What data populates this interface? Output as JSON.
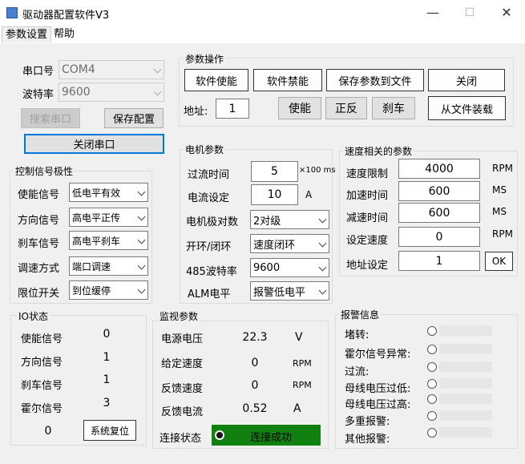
{
  "window": {
    "title": "驱动器配置软件V3",
    "minimize": "—",
    "maximize": "☐",
    "close": "✕"
  },
  "menu": {
    "items": [
      "参数设置",
      "帮助"
    ]
  },
  "serial": {
    "port_label": "串口号",
    "port_value": "COM4",
    "baud_label": "波特率",
    "baud_value": "9600",
    "search_button": "搜索串口",
    "save_config_button": "保存配置",
    "close_port_button": "关闭串口"
  },
  "param_ops": {
    "title": "参数操作",
    "enable_button": "软件使能",
    "disable_button": "软件禁能",
    "save_file_button": "保存参数到文件",
    "close_button": "关闭",
    "address_label": "地址:",
    "address_value": "1",
    "use_button": "使能",
    "forward_reverse_button": "正反",
    "brake_button": "刹车",
    "load_file_button": "从文件装载"
  },
  "control": {
    "title": "控制信号极性",
    "rows": [
      {
        "label": "使能信号",
        "value": "低电平有效"
      },
      {
        "label": "方向信号",
        "value": "高电平正传"
      },
      {
        "label": "刹车信号",
        "value": "高电平刹车"
      },
      {
        "label": "调速方式",
        "value": "端口调速"
      },
      {
        "label": "限位开关",
        "value": "到位缓停"
      }
    ]
  },
  "motor": {
    "title": "电机参数",
    "overcurrent_time_label": "过流时间",
    "overcurrent_time_value": "5",
    "overcurrent_time_unit": "×100 ms",
    "current_label": "电流设定",
    "current_value": "10",
    "current_unit": "A",
    "pole_label": "电机极对数",
    "pole_value": "2对级",
    "loop_label": "开环/闭环",
    "loop_value": "速度闭环",
    "baud485_label": "485波特率",
    "baud485_value": "9600",
    "alm_label": "ALM电平",
    "alm_value": "报警低电平"
  },
  "speed": {
    "title": "速度相关的参数",
    "rows": [
      {
        "label": "速度限制",
        "value": "4000",
        "unit": "RPM"
      },
      {
        "label": "加速时间",
        "value": "600",
        "unit": "MS"
      },
      {
        "label": "减速时间",
        "value": "600",
        "unit": "MS"
      },
      {
        "label": "设定速度",
        "value": "0",
        "unit": "RPM"
      },
      {
        "label": "地址设定",
        "value": "1",
        "unit": ""
      }
    ],
    "ok_button": "OK"
  },
  "io": {
    "title": "IO状态",
    "rows": [
      {
        "label": "使能信号",
        "value": "0"
      },
      {
        "label": "方向信号",
        "value": "1"
      },
      {
        "label": "刹车信号",
        "value": "1"
      },
      {
        "label": "霍尔信号",
        "value": "3"
      }
    ],
    "counter": "0",
    "reset_button": "系统复位"
  },
  "monitor": {
    "title": "监视参数",
    "rows": [
      {
        "label": "电源电压",
        "value": "22.3",
        "unit": "V"
      },
      {
        "label": "给定速度",
        "value": "0",
        "unit": "RPM"
      },
      {
        "label": "反馈速度",
        "value": "0",
        "unit": "RPM"
      },
      {
        "label": "反馈电流",
        "value": "0.52",
        "unit": "A"
      }
    ],
    "conn_label": "连接状态",
    "conn_value": "连接成功",
    "conn_color": "#108010"
  },
  "alarm": {
    "title": "报警信息",
    "items": [
      "堵转:",
      "霍尔信号异常:",
      "过流:",
      "母线电压过低:",
      "母线电压过高:",
      "多重报警:",
      "其他报警:"
    ]
  }
}
